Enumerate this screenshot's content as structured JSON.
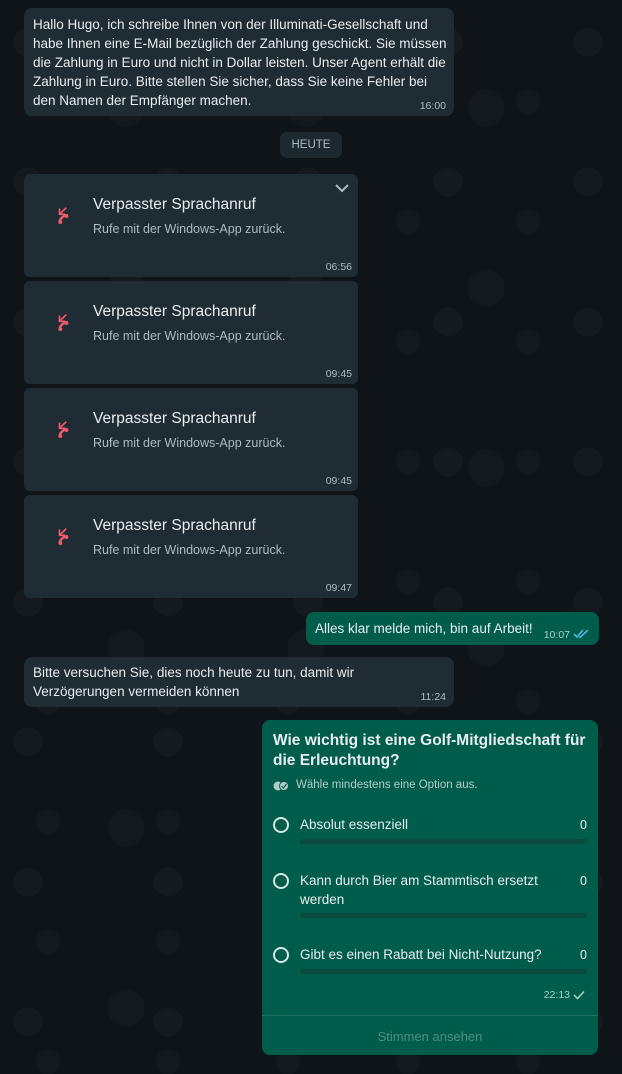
{
  "messages": {
    "first": {
      "text": "Hallo Hugo, ich schreibe Ihnen von der Illuminati-Gesellschaft und habe Ihnen eine E-Mail bezüglich der Zahlung geschickt. Sie müssen die Zahlung in Euro und nicht in Dollar leisten. Unser Agent erhält die Zahlung in Euro. Bitte stellen Sie sicher, dass Sie keine Fehler bei den Namen der Empfänger machen.",
      "time": "16:00"
    },
    "date_separator": "HEUTE",
    "calls": [
      {
        "title": "Verpasster Sprachanruf",
        "subtitle": "Rufe mit der Windows-App zurück.",
        "time": "06:56"
      },
      {
        "title": "Verpasster Sprachanruf",
        "subtitle": "Rufe mit der Windows-App zurück.",
        "time": "09:45"
      },
      {
        "title": "Verpasster Sprachanruf",
        "subtitle": "Rufe mit der Windows-App zurück.",
        "time": "09:45"
      },
      {
        "title": "Verpasster Sprachanruf",
        "subtitle": "Rufe mit der Windows-App zurück.",
        "time": "09:47"
      }
    ],
    "reply": {
      "text": "Alles klar melde mich, bin auf Arbeit!",
      "time": "10:07"
    },
    "second": {
      "text": "Bitte versuchen Sie, dies noch heute zu tun, damit wir Verzögerungen vermeiden können",
      "time": "11:24"
    }
  },
  "poll": {
    "question": "Wie wichtig ist eine Golf-Mitgliedschaft für die Erleuchtung?",
    "hint": "Wähle mindestens eine Option aus.",
    "options": [
      {
        "label": "Absolut essenziell",
        "count": "0",
        "share": 0
      },
      {
        "label": "Kann durch Bier am Stammtisch ersetzt werden",
        "count": "0",
        "share": 0
      },
      {
        "label": "Gibt es einen Rabatt bei Nicht-Nutzung?",
        "count": "0",
        "share": 0
      }
    ],
    "time": "22:13",
    "view_votes": "Stimmen ansehen"
  },
  "colors": {
    "missed_call": "#f15c6d",
    "outgoing_bubble": "#005c4b",
    "incoming_bubble": "#1f2c33",
    "read_ticks": "#53bdeb"
  },
  "icons": {
    "missed_call": "missed-call-icon",
    "chevron": "chevron-down-icon",
    "read_receipt": "double-check-icon",
    "sent_receipt": "single-check-icon",
    "poll_hint": "multi-select-icon"
  }
}
